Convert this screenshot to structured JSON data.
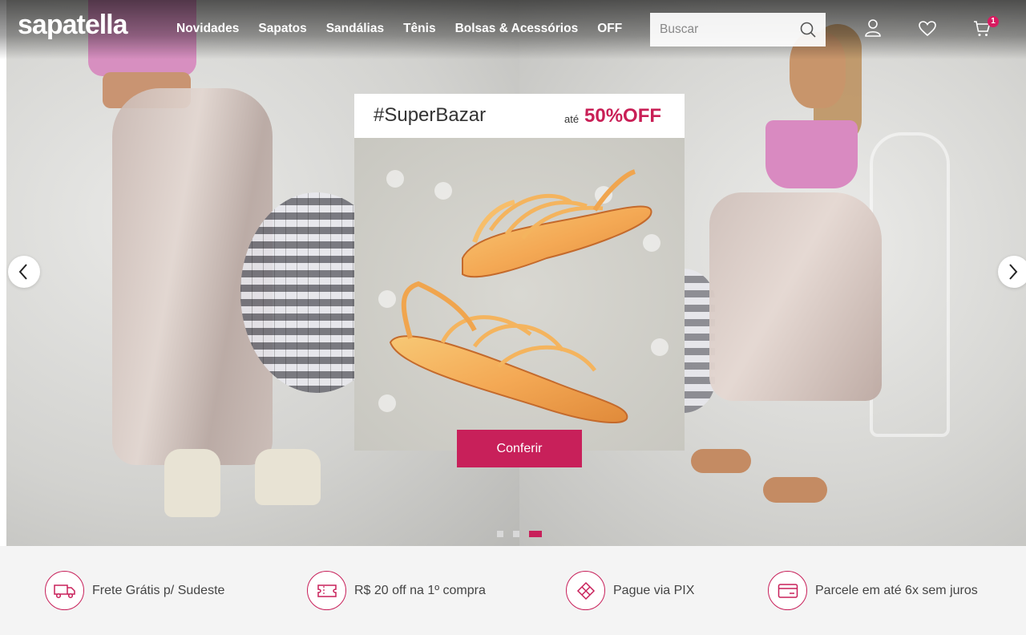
{
  "header": {
    "logo": "sapatella",
    "nav": [
      "Novidades",
      "Sapatos",
      "Sandálias",
      "Tênis",
      "Bolsas & Acessórios",
      "OFF"
    ],
    "search_placeholder": "Buscar",
    "icons": [
      "search-icon",
      "user-icon",
      "heart-icon",
      "cart-icon"
    ],
    "cart_count": "1"
  },
  "promo": {
    "title": "#SuperBazar",
    "prefix": "até",
    "discount": "50%OFF",
    "cta": "Conferir"
  },
  "carousel": {
    "slide_count": 3,
    "active_slide": 3
  },
  "benefits": [
    {
      "icon": "truck-icon",
      "text": "Frete Grátis p/ Sudeste"
    },
    {
      "icon": "ticket-icon",
      "text": "R$ 20 off na 1º compra"
    },
    {
      "icon": "pix-icon",
      "text": "Pague via PIX"
    },
    {
      "icon": "credit-card-icon",
      "text": "Parcele em até 6x sem juros"
    }
  ],
  "colors": {
    "accent": "#c8205a",
    "header_text": "#ffffff",
    "benefits_bg": "#f4f4f4"
  }
}
